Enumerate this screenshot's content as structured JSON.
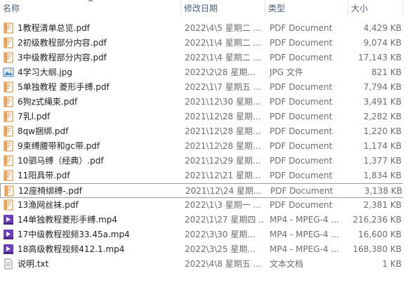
{
  "columns": {
    "name": "名称",
    "date": "修改日期",
    "type": "类型",
    "size": "大小"
  },
  "files": [
    {
      "name": "1教程清单总览.pdf",
      "date": "2022\\4\\5 星期二 ...",
      "type": "PDF Document",
      "size": "4,429 KB",
      "icon": "pdf-icon"
    },
    {
      "name": "2初级教程部分内容.pdf",
      "date": "2022\\1\\4 星期二 ...",
      "type": "PDF Document",
      "size": "9,074 KB",
      "icon": "pdf-icon"
    },
    {
      "name": "3中级教程部分内容.pdf",
      "date": "2022\\1\\4 星期二 ...",
      "type": "PDF Document",
      "size": "17,143 KB",
      "icon": "pdf-icon"
    },
    {
      "name": "4学习大纲.jpg",
      "date": "2022\\2\\28 星期...",
      "type": "JPG 文件",
      "size": "821 KB",
      "icon": "image-icon"
    },
    {
      "name": "5单独教程 菱形手缚.pdf",
      "date": "2022\\1\\7 星期五 ...",
      "type": "PDF Document",
      "size": "7,794 KB",
      "icon": "pdf-icon"
    },
    {
      "name": "6狗z式绳束.pdf",
      "date": "2021\\12\\30 星期...",
      "type": "PDF Document",
      "size": "3,491 KB",
      "icon": "pdf-icon"
    },
    {
      "name": "7乳l.pdf",
      "date": "2021\\12\\28 星期...",
      "type": "PDF Document",
      "size": "2,282 KB",
      "icon": "pdf-icon"
    },
    {
      "name": "8qw捆绑.pdf",
      "date": "2021\\12\\28 星期...",
      "type": "PDF Document",
      "size": "1,220 KB",
      "icon": "pdf-icon"
    },
    {
      "name": "9束缚腰带和gc带.pdf",
      "date": "2021\\12\\28 星期...",
      "type": "PDF Document",
      "size": "1,174 KB",
      "icon": "pdf-icon"
    },
    {
      "name": "10驷马缚（经典）.pdf",
      "date": "2021\\12\\29 星期...",
      "type": "PDF Document",
      "size": "1,377 KB",
      "icon": "pdf-icon"
    },
    {
      "name": "11阳具带.pdf",
      "date": "2021\\12\\21 星期...",
      "type": "PDF Document",
      "size": "1,834 KB",
      "icon": "pdf-icon"
    },
    {
      "name": "12座椅绑缚-.pdf",
      "date": "2021\\12\\24 星期...",
      "type": "PDF Document",
      "size": "3,138 KB",
      "icon": "pdf-icon",
      "selected": true
    },
    {
      "name": "13渔网丝袜.pdf",
      "date": "2022\\1\\3 星期一 ...",
      "type": "PDF Document",
      "size": "2,381 KB",
      "icon": "pdf-icon"
    },
    {
      "name": "14单独教程菱形手缚.mp4",
      "date": "2022\\1\\27 星期四 ...",
      "type": "MP4 - MPEG-4 ...",
      "size": "216,236 KB",
      "icon": "video-icon"
    },
    {
      "name": "17中级教程视频33.45a.mp4",
      "date": "2022\\3\\30 星期...",
      "type": "MP4 - MPEG-4 ...",
      "size": "16,600 KB",
      "icon": "video-icon"
    },
    {
      "name": "18高级教程视频412.1.mp4",
      "date": "2022\\3\\25 星期...",
      "type": "MP4 - MPEG-4 ...",
      "size": "168,380 KB",
      "icon": "video-icon"
    },
    {
      "name": "说明.txt",
      "date": "2022\\4\\8 星期五 ...",
      "type": "文本文档",
      "size": "1 KB",
      "icon": "text-file-icon"
    }
  ],
  "colors": {
    "pdf": "#d9822b",
    "video": "#6b3fb8",
    "header_text": "#4c607a",
    "selection_border": "#9a9a9a"
  }
}
